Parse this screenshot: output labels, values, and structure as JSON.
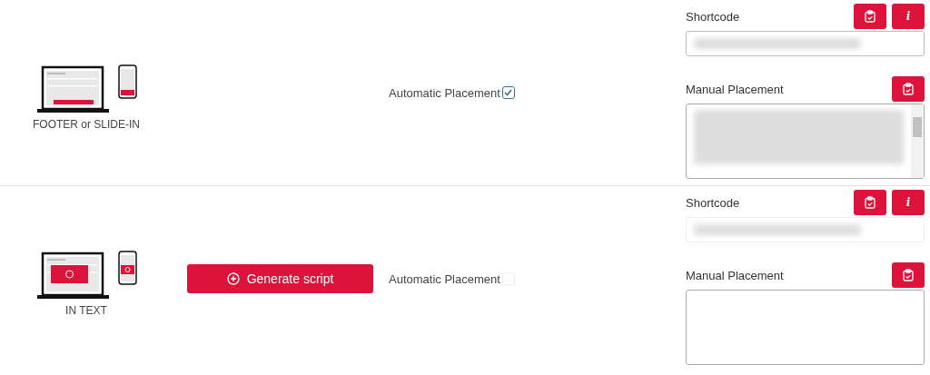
{
  "rows": [
    {
      "illustration": {
        "kind": "footer",
        "caption": "FOOTER or SLIDE-IN"
      },
      "automatic_placement": {
        "label": "Automatic Placement",
        "checked": true,
        "disabled": false
      },
      "shortcode": {
        "label": "Shortcode",
        "redacted": true,
        "disabled": false,
        "info": "i"
      },
      "manual_placement": {
        "label": "Manual Placement",
        "redacted": true,
        "scrollbar": true
      }
    },
    {
      "illustration": {
        "kind": "in_text",
        "caption": "IN TEXT"
      },
      "generate_button": {
        "label": "Generate script"
      },
      "automatic_placement": {
        "label": "Automatic Placement",
        "checked": false,
        "disabled": true
      },
      "shortcode": {
        "label": "Shortcode",
        "redacted": true,
        "disabled": true,
        "info": "i"
      },
      "manual_placement": {
        "label": "Manual Placement",
        "redacted": false,
        "scrollbar": false
      }
    }
  ]
}
